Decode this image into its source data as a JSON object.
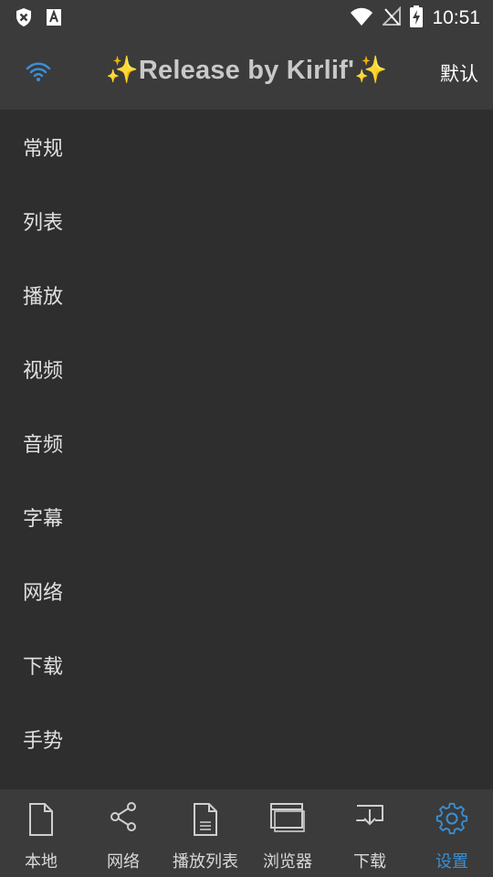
{
  "status_bar": {
    "time": "10:51",
    "left_icons": [
      "shield-x-icon",
      "font-a-icon"
    ],
    "right_icons": [
      "wifi-icon",
      "no-signal-icon",
      "battery-charging-icon"
    ]
  },
  "app_bar": {
    "title": "✨Release by Kirlif'✨",
    "action": "默认",
    "left_icon": "wifi-icon"
  },
  "menu": {
    "items": [
      {
        "label": "常规"
      },
      {
        "label": "列表"
      },
      {
        "label": "播放"
      },
      {
        "label": "视频"
      },
      {
        "label": "音频"
      },
      {
        "label": "字幕"
      },
      {
        "label": "网络"
      },
      {
        "label": "下载"
      },
      {
        "label": "手势"
      }
    ]
  },
  "bottom_nav": {
    "items": [
      {
        "label": "本地",
        "icon": "file-icon"
      },
      {
        "label": "网络",
        "icon": "share-icon"
      },
      {
        "label": "播放列表",
        "icon": "document-list-icon"
      },
      {
        "label": "浏览器",
        "icon": "browser-window-icon"
      },
      {
        "label": "下载",
        "icon": "download-tray-icon"
      },
      {
        "label": "设置",
        "icon": "gear-icon",
        "active": true
      }
    ]
  },
  "colors": {
    "background": "#2e2e2e",
    "bar": "#3b3b3b",
    "accent": "#3a8fd6",
    "title": "#c9c9c9"
  }
}
